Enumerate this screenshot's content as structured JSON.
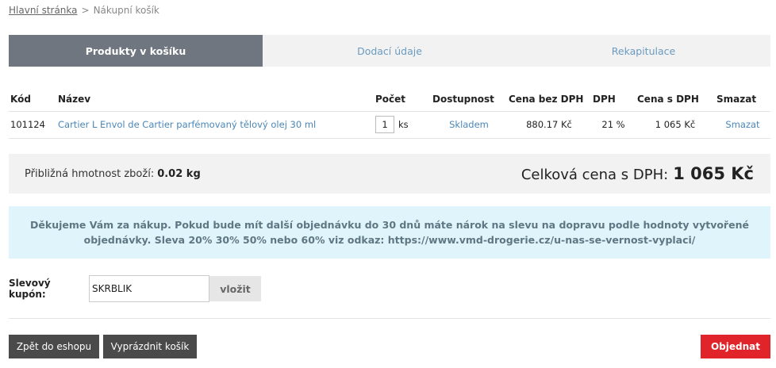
{
  "breadcrumb": {
    "home": "Hlavní stránka",
    "separator": ">",
    "current": "Nákupní košík"
  },
  "steps": {
    "step1": "Produkty v košíku",
    "step2": "Dodací údaje",
    "step3": "Rekapitulace"
  },
  "table": {
    "headers": {
      "code": "Kód",
      "name": "Název",
      "qty": "Počet",
      "availability": "Dostupnost",
      "price": "Cena bez DPH",
      "vat": "DPH",
      "total": "Cena s DPH",
      "delete": "Smazat"
    },
    "rows": [
      {
        "code": "101124",
        "name": "Cartier L Envol de Cartier parfémovaný tělový olej 30 ml",
        "qty": "1",
        "unit": "ks",
        "availability": "Skladem",
        "price": "880.17 Kč",
        "vat": "21 %",
        "total": "1 065 Kč",
        "delete": "Smazat"
      }
    ]
  },
  "summary": {
    "weight_label": "Přibližná hmotnost zboží:",
    "weight": "0.02 kg",
    "total_label": "Celková cena s DPH:",
    "total": "1 065 Kč"
  },
  "notice": "Děkujeme Vám za nákup. Pokud bude mít další objednávku do 30 dnů máte nárok na slevu na dopravu podle hodnoty vytvořené objednávky. Sleva 20% 30% 50% nebo 60% viz odkaz: https://www.vmd-drogerie.cz/u-nas-se-vernost-vyplaci/",
  "coupon": {
    "label": "Slevový kupón:",
    "value": "SKRBLIK",
    "button": "vložit"
  },
  "buttons": {
    "back": "Zpět do eshopu",
    "empty": "Vyprázdnit košík",
    "order": "Objednat"
  },
  "colors": {
    "active_step": "#6f7680",
    "link": "#4a87b9",
    "order_button": "#e0242a",
    "dark_button": "#4a4a4a",
    "notice_bg": "#e0f4fb"
  }
}
